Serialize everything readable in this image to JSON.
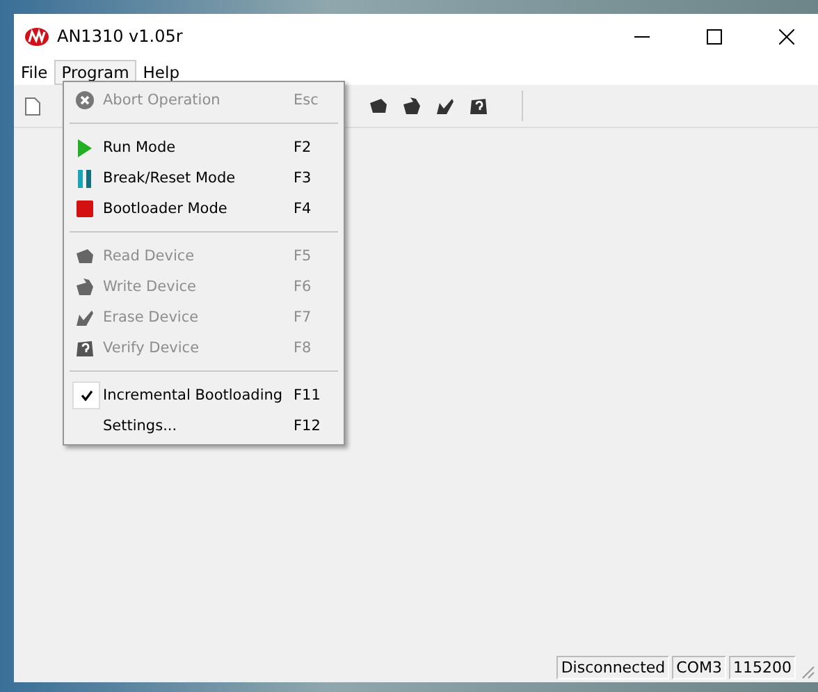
{
  "window": {
    "title": "AN1310 v1.05r"
  },
  "menubar": [
    {
      "label": "File",
      "selected": false
    },
    {
      "label": "Program",
      "selected": true
    },
    {
      "label": "Help",
      "selected": false
    }
  ],
  "menu": [
    {
      "kind": "item",
      "label": "Abort Operation",
      "shortcut": "Esc",
      "disabled": true,
      "checked": false
    },
    {
      "kind": "separator"
    },
    {
      "kind": "item",
      "label": "Run Mode",
      "shortcut": "F2",
      "disabled": false,
      "checked": false
    },
    {
      "kind": "item",
      "label": "Break/Reset Mode",
      "shortcut": "F3",
      "disabled": false,
      "checked": false
    },
    {
      "kind": "item",
      "label": "Bootloader Mode",
      "shortcut": "F4",
      "disabled": false,
      "checked": false
    },
    {
      "kind": "separator"
    },
    {
      "kind": "item",
      "label": "Read Device",
      "shortcut": "F5",
      "disabled": true,
      "checked": false
    },
    {
      "kind": "item",
      "label": "Write Device",
      "shortcut": "F6",
      "disabled": true,
      "checked": false
    },
    {
      "kind": "item",
      "label": "Erase Device",
      "shortcut": "F7",
      "disabled": true,
      "checked": false
    },
    {
      "kind": "item",
      "label": "Verify Device",
      "shortcut": "F8",
      "disabled": true,
      "checked": false
    },
    {
      "kind": "separator"
    },
    {
      "kind": "item",
      "label": "Incremental Bootloading",
      "shortcut": "F11",
      "disabled": false,
      "checked": true
    },
    {
      "kind": "item",
      "label": "Settings...",
      "shortcut": "F12",
      "disabled": false,
      "checked": false
    }
  ],
  "status_bar": [
    "Disconnected",
    "COM3",
    "115200"
  ]
}
